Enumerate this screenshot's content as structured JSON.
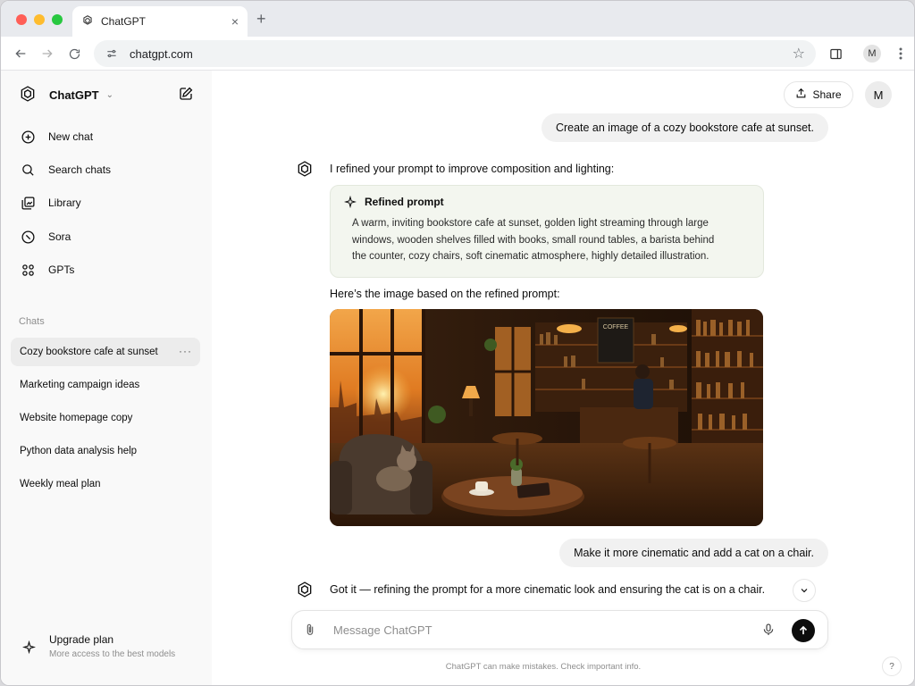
{
  "browser": {
    "tab_title": "ChatGPT",
    "tab_close": "×",
    "new_tab": "+",
    "url": "chatgpt.com",
    "profile_initial": "M"
  },
  "sidebar": {
    "app_name": "ChatGPT",
    "nav": [
      {
        "label": "New chat",
        "icon": "new-chat-icon"
      },
      {
        "label": "Search chats",
        "icon": "search-icon"
      },
      {
        "label": "Library",
        "icon": "library-icon"
      },
      {
        "label": "Sora",
        "icon": "sora-icon"
      },
      {
        "label": "GPTs",
        "icon": "gpts-icon"
      }
    ],
    "chats_label": "Chats",
    "chats": [
      {
        "title": "Cozy bookstore cafe at sunset",
        "active": true
      },
      {
        "title": "Marketing campaign ideas"
      },
      {
        "title": "Website homepage copy"
      },
      {
        "title": "Python data analysis help"
      },
      {
        "title": "Weekly meal plan"
      }
    ],
    "more_glyph": "···",
    "upgrade": {
      "title": "Upgrade plan",
      "subtitle": "More access to the best models"
    }
  },
  "header": {
    "share_label": "Share",
    "avatar_initial": "M"
  },
  "conversation": {
    "user_msg_1": "Create an image of a cozy bookstore cafe at sunset.",
    "bot_msg_1": "I refined your prompt to improve composition and lighting:",
    "refined_title": "Refined prompt",
    "refined_lines": [
      "A warm, inviting bookstore cafe at sunset, golden light streaming through large",
      "windows, wooden shelves filled with books, small round tables, a barista behind",
      "the counter, cozy chairs, soft cinematic atmosphere, highly detailed illustration."
    ],
    "bot_msg_2": "Here’s the image based on the refined prompt:",
    "image_sign": "COFFEE",
    "user_msg_2": "Make it more cinematic and add a cat on a chair.",
    "bot_msg_3": "Got it — refining the prompt for a more cinematic look and ensuring the cat is on a chair."
  },
  "composer": {
    "placeholder": "Message ChatGPT",
    "value": ""
  },
  "footer": {
    "disclaimer": "ChatGPT can make mistakes. Check important info.",
    "help": "?"
  },
  "colors": {
    "sidebar_bg": "#f9f9f9",
    "user_bubble": "#f1f1f1",
    "refined_card_bg": "#f3f6ef",
    "send_button": "#0d0d0d"
  }
}
